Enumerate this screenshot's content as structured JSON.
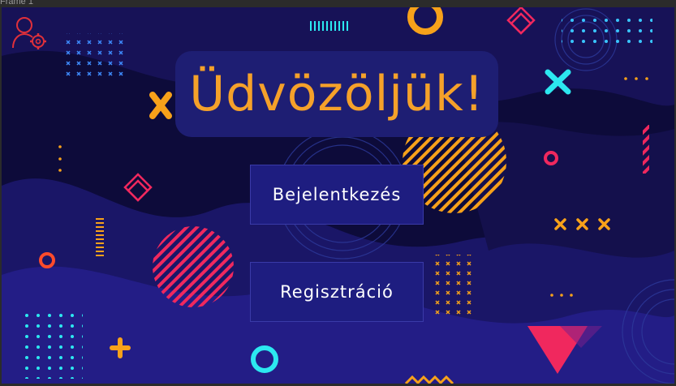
{
  "frame": {
    "label": "Frame 1"
  },
  "header": {
    "title": "Üdvözöljük!"
  },
  "actions": {
    "login_label": "Bejelentkezés",
    "register_label": "Regisztráció"
  },
  "icons": {
    "account": "user-settings-icon"
  },
  "colors": {
    "background": "#0d0b3a",
    "title_box": "#1e1e73",
    "title_text": "#f5a12a",
    "button": "#1e1d80",
    "accent_orange": "#f7a11a",
    "accent_cyan": "#2ce8f0",
    "accent_pink": "#f0285e",
    "accent_red": "#e0303a"
  }
}
